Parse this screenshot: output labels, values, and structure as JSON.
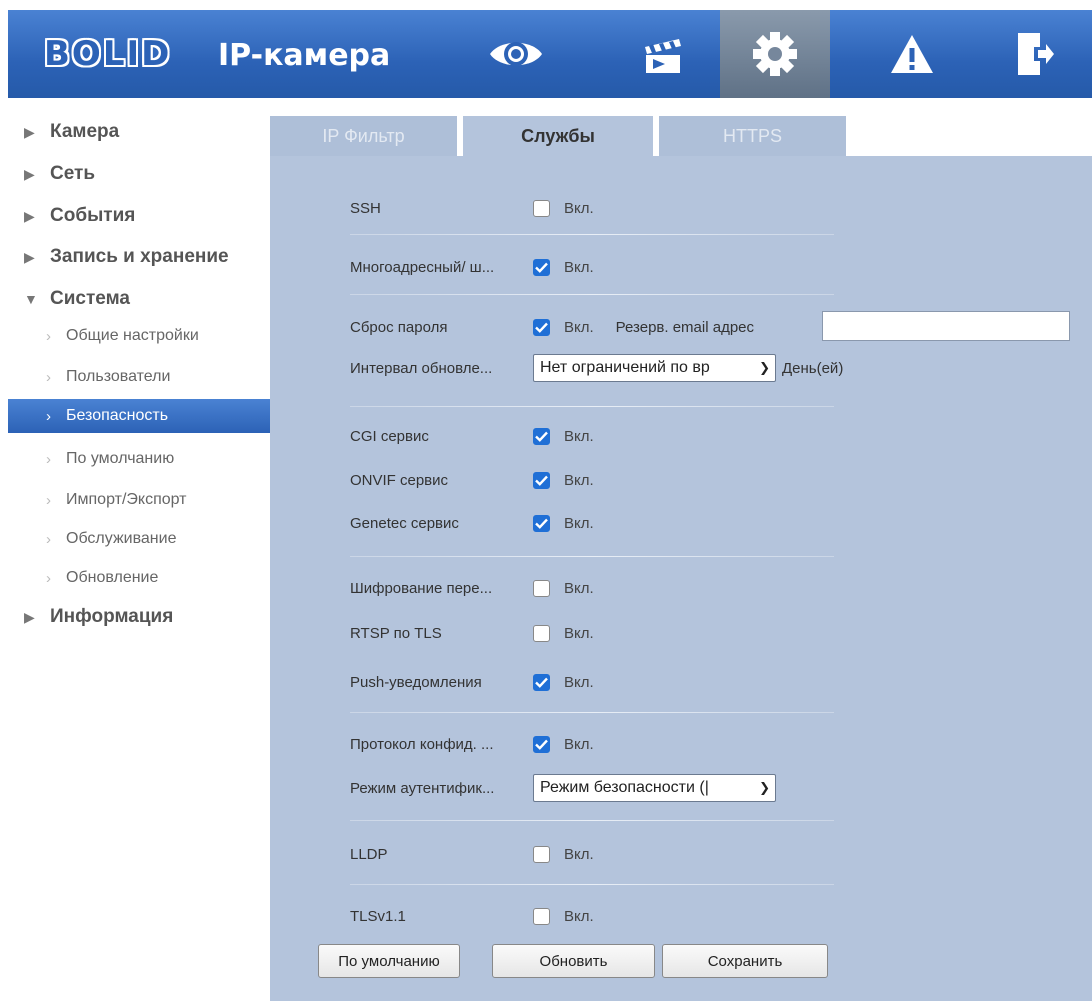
{
  "header": {
    "logo": "BOLID",
    "title": "IP-камера",
    "nav": [
      {
        "name": "live-view",
        "icon": "eye-icon"
      },
      {
        "name": "playback",
        "icon": "clapperboard-icon"
      },
      {
        "name": "settings",
        "icon": "gear-icon",
        "active": true
      },
      {
        "name": "alarm",
        "icon": "warning-icon"
      },
      {
        "name": "logout",
        "icon": "exit-door-icon"
      }
    ]
  },
  "sidebar": {
    "main": [
      "Камера",
      "Сеть",
      "События",
      "Запись и хранение",
      "Система",
      "Информация"
    ],
    "system_sub": [
      "Общие настройки",
      "Пользователи",
      "Безопасность",
      "По умолчанию",
      "Импорт/Экспорт",
      "Обслуживание",
      "Обновление"
    ],
    "active_sub": "Безопасность"
  },
  "tabs": [
    "IP Фильтр",
    "Службы",
    "HTTPS"
  ],
  "active_tab": "Службы",
  "form": {
    "on_label": "Вкл.",
    "rows": {
      "ssh": {
        "label": "SSH",
        "checked": false
      },
      "multicast": {
        "label": "Многоадресный/ ш...",
        "checked": true
      },
      "reset_password": {
        "label": "Сброс пароля",
        "checked": true
      },
      "update_interval": {
        "label": "Интервал обновле...",
        "value": "Нет ограничений по вр",
        "unit": "День(ей)"
      },
      "cgi": {
        "label": "CGI сервис",
        "checked": true
      },
      "onvif": {
        "label": "ONVIF сервис",
        "checked": true
      },
      "genetec": {
        "label": "Genetec сервис",
        "checked": true
      },
      "encryption": {
        "label": "Шифрование пере...",
        "checked": false
      },
      "rtsp_tls": {
        "label": "RTSP по TLS",
        "checked": false
      },
      "push": {
        "label": "Push-уведомления",
        "checked": true
      },
      "privacy": {
        "label": "Протокол конфид. ...",
        "checked": true
      },
      "auth_mode": {
        "label": "Режим аутентифик...",
        "value": "Режим безопасности (|"
      },
      "lldp": {
        "label": "LLDP",
        "checked": false
      },
      "tls11": {
        "label": "TLSv1.1",
        "checked": false
      }
    },
    "backup_email_label": "Резерв. email адрес",
    "backup_email_value": ""
  },
  "buttons": {
    "default": "По умолчанию",
    "refresh": "Обновить",
    "save": "Сохранить"
  },
  "colors": {
    "header": "#2c62b6",
    "panel": "#b4c4dc",
    "checkbox": "#1f6fd6"
  }
}
